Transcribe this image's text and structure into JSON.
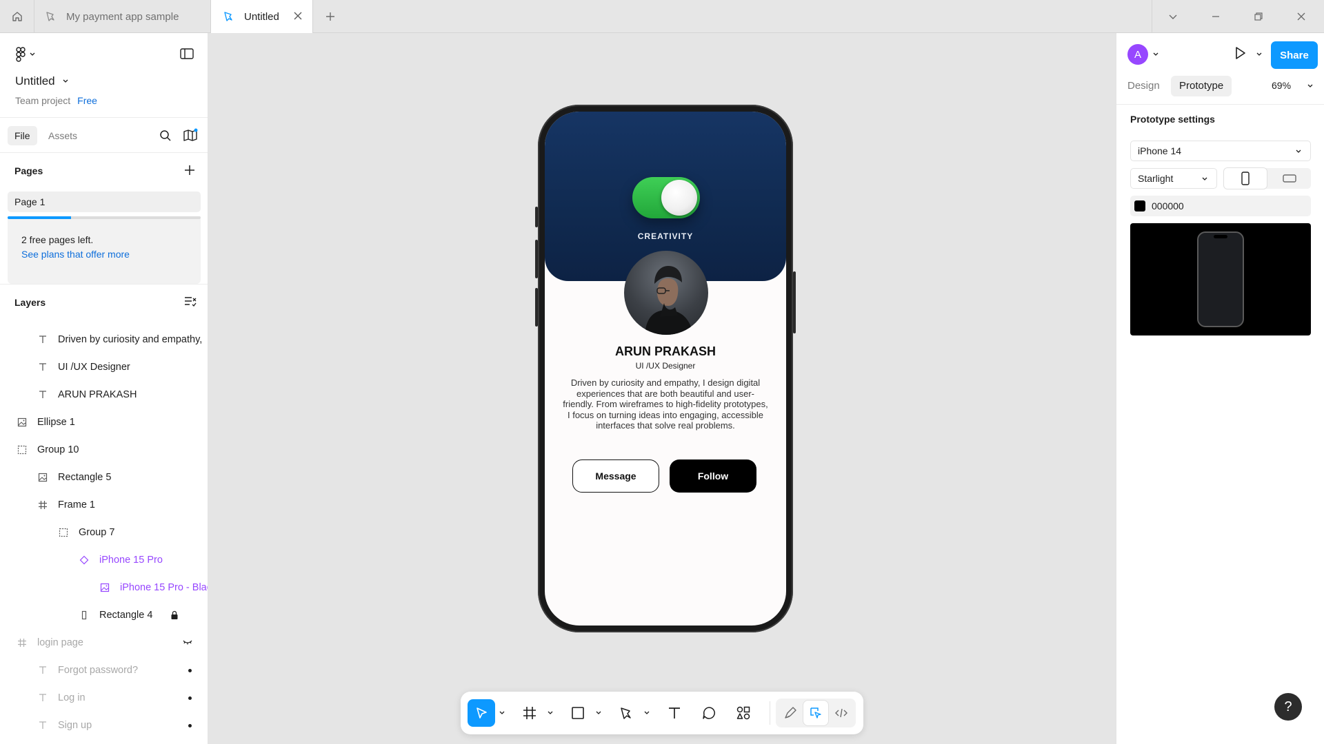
{
  "tabs": {
    "home_icon": "home-icon",
    "items": [
      {
        "label": "My payment app sample",
        "icon": "figma-file-icon"
      },
      {
        "label": "Untitled",
        "icon": "figma-file-icon",
        "active": true
      }
    ],
    "new_tab_icon": "plus-icon",
    "window_controls": [
      "chevron-down-icon",
      "minimize-icon",
      "restore-icon",
      "close-icon"
    ]
  },
  "file": {
    "title": "Untitled",
    "team": "Team project",
    "plan": "Free"
  },
  "left_tabs": {
    "file": "File",
    "assets": "Assets"
  },
  "pages": {
    "heading": "Pages",
    "items": [
      "Page 1"
    ],
    "usage_fraction": 0.33,
    "free_notice": "2 free pages left.",
    "upgrade_link": "See plans that offer more"
  },
  "layers": {
    "heading": "Layers",
    "items": [
      {
        "label": "Driven by curiosity and empathy,",
        "icon": "text-icon",
        "depth": 1
      },
      {
        "label": "UI /UX Designer",
        "icon": "text-icon",
        "depth": 1
      },
      {
        "label": "ARUN PRAKASH",
        "icon": "text-icon",
        "depth": 1
      },
      {
        "label": "Ellipse 1",
        "icon": "image-icon",
        "depth": 0
      },
      {
        "label": "Group 10",
        "icon": "group-icon",
        "depth": 0
      },
      {
        "label": "Rectangle 5",
        "icon": "image-icon",
        "depth": 1
      },
      {
        "label": "Frame 1",
        "icon": "frame-icon",
        "depth": 1
      },
      {
        "label": "Group 7",
        "icon": "group-icon",
        "depth": 2
      },
      {
        "label": "iPhone 15 Pro",
        "icon": "component-icon",
        "depth": 3
      },
      {
        "label": "iPhone 15 Pro - Blac",
        "icon": "image-icon",
        "depth": 4
      },
      {
        "label": "Rectangle 4",
        "icon": "rectangle-icon",
        "depth": 3,
        "locked": true
      },
      {
        "label": "login page",
        "icon": "frame-icon",
        "depth": 0,
        "hidden": true
      },
      {
        "label": "Forgot password?",
        "icon": "text-icon",
        "depth": 1,
        "hidden": true
      },
      {
        "label": "Log in",
        "icon": "text-icon",
        "depth": 1,
        "hidden": true
      },
      {
        "label": "Sign up",
        "icon": "text-icon",
        "depth": 1,
        "hidden": true
      }
    ]
  },
  "canvas": {
    "phone": {
      "toggle_on": true,
      "toggle_color": "#2fbf48",
      "hero_color": "#123060",
      "label": "CREATIVITY",
      "name": "ARUN PRAKASH",
      "role": "UI /UX Designer",
      "bio": "Driven by curiosity and empathy, I design digital experiences that are both beautiful and user-friendly. From wireframes to high-fidelity prototypes, I focus on turning ideas into engaging, accessible interfaces that solve real problems.",
      "message_button": "Message",
      "follow_button": "Follow"
    },
    "toolbar": {
      "tools": [
        "move-icon",
        "frame-icon",
        "rectangle-icon",
        "pen-icon",
        "text-icon",
        "comment-icon",
        "actions-icon"
      ],
      "modes": [
        "draw-icon",
        "design-mode-icon",
        "dev-mode-icon"
      ],
      "accent": "#0d99ff"
    }
  },
  "right": {
    "user_initial": "A",
    "share": "Share",
    "tabs": {
      "design": "Design",
      "prototype": "Prototype"
    },
    "zoom": "69%",
    "prototype_settings": {
      "heading": "Prototype settings",
      "device": "iPhone 14",
      "model": "Starlight",
      "background_color": "000000"
    }
  },
  "help": "?"
}
